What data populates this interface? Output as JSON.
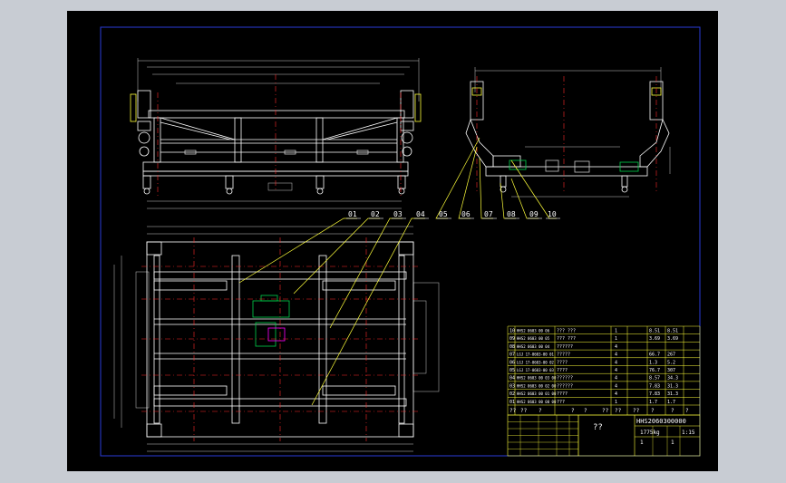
{
  "colors": {
    "background": "#c8ccd3",
    "sheet": "#000000",
    "frame": "#2a3bd8",
    "geometry": "#ffffff",
    "centerline": "#ff2b2b",
    "leader": "#ffff3a",
    "dimension": "#c9c9c9",
    "detail": "#00d24a",
    "accent": "#ff00ff"
  },
  "callouts": [
    "01",
    "02",
    "03",
    "04",
    "05",
    "06",
    "07",
    "08",
    "09",
    "10"
  ],
  "parts_list": {
    "rows": [
      {
        "no": "10",
        "code": "HHS2 0603 00 06",
        "name": "??? ???",
        "qty": "1",
        "mass": "8.51",
        "total": "8.51"
      },
      {
        "no": "09",
        "code": "HHS2 0603 00 05",
        "name": "??? ???",
        "qty": "1",
        "mass": "3.69",
        "total": "3.69"
      },
      {
        "no": "08",
        "code": "HHS2 0603 00 04",
        "name": "??????",
        "qty": "4",
        "mass": "",
        "total": ""
      },
      {
        "no": "07",
        "code": "LGJ 17-0603-00 01",
        "name": "?????",
        "qty": "4",
        "mass": "66.7",
        "total": "267"
      },
      {
        "no": "06",
        "code": "LGJ 17-0603-00 02",
        "name": "????",
        "qty": "4",
        "mass": "1.3",
        "total": "5.2"
      },
      {
        "no": "05",
        "code": "LGJ 17-0603-00 03",
        "name": "????",
        "qty": "4",
        "mass": "76.7",
        "total": "307"
      },
      {
        "no": "04",
        "code": "HHS2 0603 00 03 00",
        "name": "??????",
        "qty": "4",
        "mass": "8.57",
        "total": "34.3"
      },
      {
        "no": "03",
        "code": "HHS2 0603 00 02 00",
        "name": "??????",
        "qty": "4",
        "mass": "7.83",
        "total": "31.3"
      },
      {
        "no": "02",
        "code": "HHS2 0603 00 01 00",
        "name": "????",
        "qty": "4",
        "mass": "7.83",
        "total": "31.3"
      },
      {
        "no": "01",
        "code": "HHS2 0603 00 00 00",
        "name": "???",
        "qty": "1",
        "mass": "1.7",
        "total": "1.7"
      }
    ],
    "header": [
      "??",
      "??",
      "?",
      "?",
      "?",
      "??",
      "??",
      "??",
      "?",
      "?",
      "?"
    ]
  },
  "title_block": {
    "drawing_no": "HHS2060300000",
    "name": "??",
    "scale": "1:15",
    "mass": "1775kg",
    "sheet": "1",
    "sheets": "1"
  }
}
